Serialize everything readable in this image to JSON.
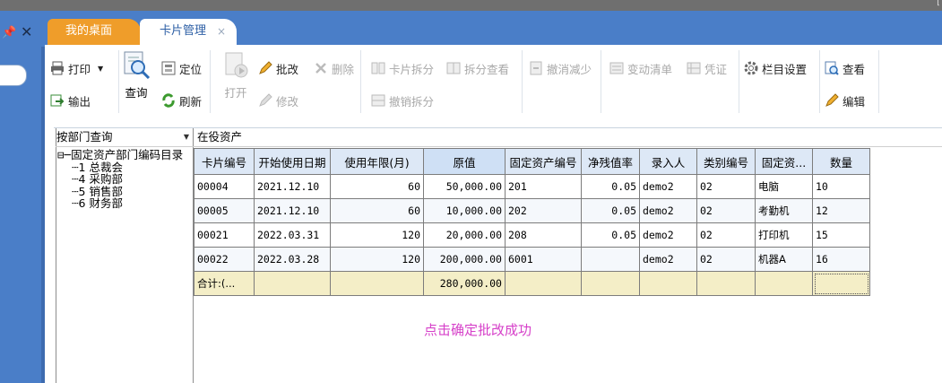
{
  "left_panel": {
    "search": {
      "value": ""
    }
  },
  "tabs": [
    {
      "label": "我的桌面"
    },
    {
      "label": "卡片管理",
      "close": "×"
    }
  ],
  "toolbar": {
    "print": "打印",
    "export": "输出",
    "query": "查询",
    "locate": "定位",
    "refresh": "刷新",
    "open": "打开",
    "approve_change": "批改",
    "delete": "删除",
    "modify": "修改",
    "split_card": "卡片拆分",
    "split_view": "拆分查看",
    "undo_split": "撤销拆分",
    "undo_reduce": "撤消减少",
    "change_list": "变动清单",
    "voucher": "凭证",
    "column_settings": "栏目设置",
    "view": "查看",
    "edit": "编辑"
  },
  "filter": {
    "dept_query": "按部门查询",
    "status": "在役资产"
  },
  "tree": {
    "root": "固定资产部门编码目录",
    "items": [
      {
        "code": "1",
        "name": "总裁会"
      },
      {
        "code": "4",
        "name": "采购部"
      },
      {
        "code": "5",
        "name": "销售部"
      },
      {
        "code": "6",
        "name": "财务部"
      }
    ]
  },
  "grid": {
    "columns": [
      "卡片编号",
      "开始使用日期",
      "使用年限(月)",
      "原值",
      "固定资产编号",
      "净残值率",
      "录入人",
      "类别编号",
      "固定资...",
      "数量"
    ],
    "rows": [
      [
        "00004",
        "2021.12.10",
        "60",
        "50,000.00",
        "201",
        "0.05",
        "demo2",
        "02",
        "电脑",
        "10"
      ],
      [
        "00005",
        "2021.12.10",
        "60",
        "10,000.00",
        "202",
        "0.05",
        "demo2",
        "02",
        "考勤机",
        "12"
      ],
      [
        "00021",
        "2022.03.31",
        "120",
        "20,000.00",
        "208",
        "0.05",
        "demo2",
        "02",
        "打印机",
        "15"
      ],
      [
        "00022",
        "2022.03.28",
        "120",
        "200,000.00",
        "6001",
        "",
        "demo2",
        "02",
        "机器A",
        "16"
      ]
    ],
    "summary": {
      "label": "合计:(...",
      "total": "280,000.00"
    }
  },
  "message": "点击确定批改成功",
  "colors": {
    "accent_blue": "#4a7ec8",
    "tab_orange": "#ef9d2a",
    "message_pink": "#d640c9",
    "summary_bg": "#f4eec7"
  }
}
